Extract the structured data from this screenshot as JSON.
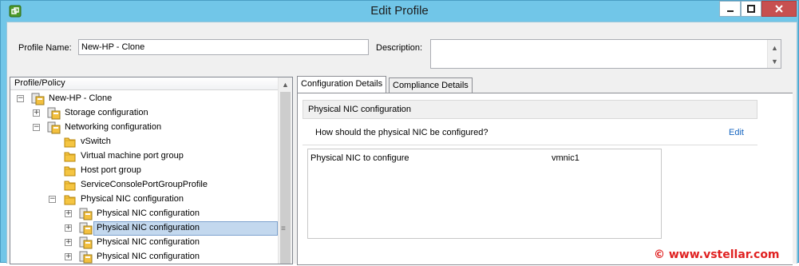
{
  "window": {
    "title": "Edit Profile",
    "app_icon": "vsphere-client-icon",
    "controls": [
      "minimize-icon",
      "maximize-icon",
      "close-icon"
    ]
  },
  "form": {
    "profile_name_label": "Profile Name:",
    "profile_name_value": "New-HP - Clone",
    "description_label": "Description:",
    "description_value": ""
  },
  "tree": {
    "header": "Profile/Policy",
    "items": [
      {
        "label": "New-HP - Clone",
        "depth": 0,
        "expander": "⊟",
        "icon": "host-profile-icon"
      },
      {
        "label": "Storage configuration",
        "depth": 1,
        "expander": "⊞",
        "icon": "policy-icon"
      },
      {
        "label": "Networking configuration",
        "depth": 1,
        "expander": "⊟",
        "icon": "policy-icon"
      },
      {
        "label": "vSwitch",
        "depth": 2,
        "expander": "",
        "icon": "folder-icon"
      },
      {
        "label": "Virtual machine port group",
        "depth": 2,
        "expander": "",
        "icon": "folder-icon"
      },
      {
        "label": "Host port group",
        "depth": 2,
        "expander": "",
        "icon": "folder-icon"
      },
      {
        "label": "ServiceConsolePortGroupProfile",
        "depth": 2,
        "expander": "",
        "icon": "folder-icon"
      },
      {
        "label": "Physical NIC configuration",
        "depth": 2,
        "expander": "⊟",
        "icon": "folder-icon"
      },
      {
        "label": "Physical NIC configuration",
        "depth": 3,
        "expander": "⊞",
        "icon": "policy-icon"
      },
      {
        "label": "Physical NIC configuration",
        "depth": 3,
        "expander": "⊞",
        "icon": "policy-icon",
        "selected": true
      },
      {
        "label": "Physical NIC configuration",
        "depth": 3,
        "expander": "⊞",
        "icon": "policy-icon"
      },
      {
        "label": "Physical NIC configuration",
        "depth": 3,
        "expander": "⊞",
        "icon": "policy-icon"
      }
    ]
  },
  "tabs": [
    {
      "label": "Configuration Details",
      "active": true
    },
    {
      "label": "Compliance Details",
      "active": false
    }
  ],
  "details": {
    "section_title": "Physical NIC configuration",
    "question": "How should the physical NIC be configured?",
    "edit_link": "Edit",
    "field_label": "Physical NIC to configure",
    "field_value": "vmnic1"
  },
  "watermark": "© www.vstellar.com",
  "colors": {
    "titlebar": "#71c6e8",
    "close_button": "#c75050",
    "selection": "#c3d8ee",
    "link": "#1565c0",
    "watermark": "#e02020"
  }
}
